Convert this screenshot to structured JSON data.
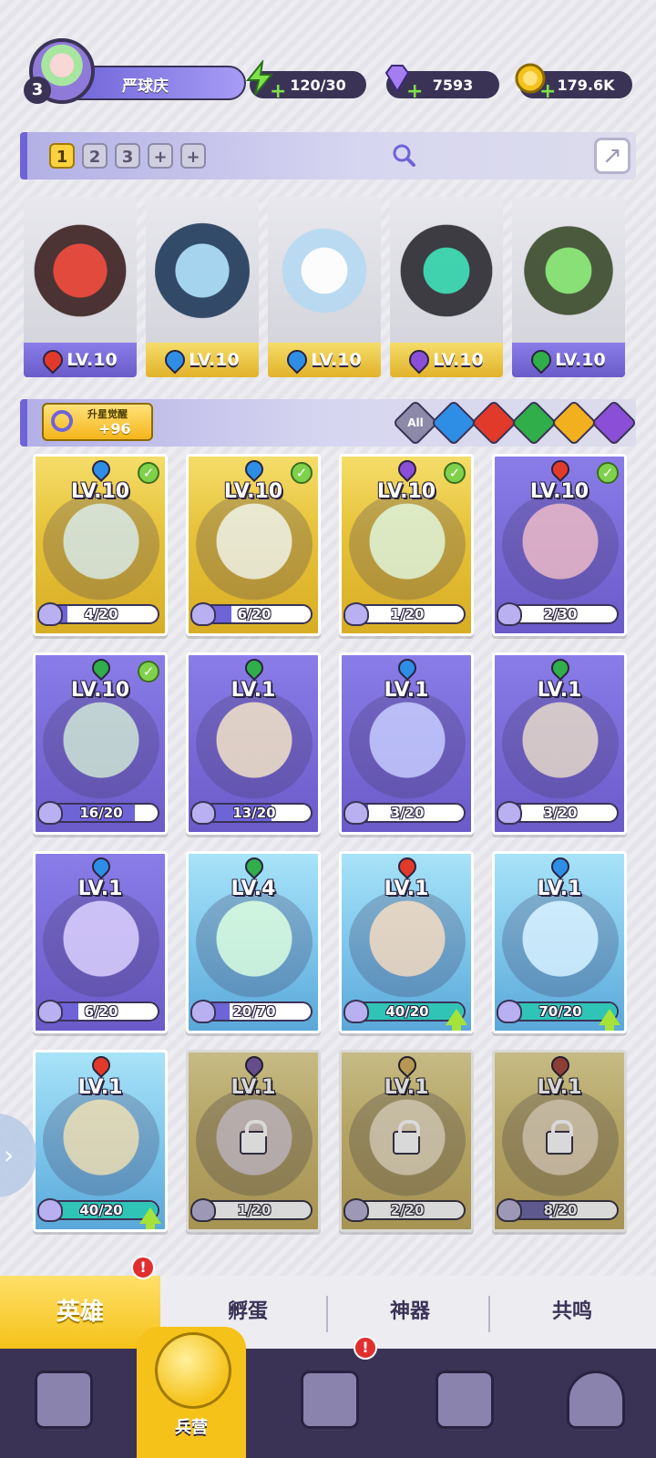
{
  "player": {
    "level": "3",
    "name": "严球庆"
  },
  "resources": {
    "energy": "120/30",
    "gems": "7593",
    "coins": "179.6K"
  },
  "team_tabs": [
    "1",
    "2",
    "3",
    "+",
    "+"
  ],
  "team_slots": [
    {
      "level": "LV.10",
      "element": "fire"
    },
    {
      "level": "LV.10",
      "element": "water"
    },
    {
      "level": "LV.10",
      "element": "water"
    },
    {
      "level": "LV.10",
      "element": "moon"
    },
    {
      "level": "LV.10",
      "element": "nature"
    }
  ],
  "awaken": {
    "label": "升星觉醒",
    "value": "+96"
  },
  "element_filters": [
    "All",
    "water",
    "fire",
    "nature",
    "light",
    "moon"
  ],
  "heroes": [
    {
      "level": "LV.10",
      "progress": "4/20",
      "element": "water",
      "card": "gold",
      "checked": true
    },
    {
      "level": "LV.10",
      "progress": "6/20",
      "element": "water",
      "card": "gold",
      "checked": true
    },
    {
      "level": "LV.10",
      "progress": "1/20",
      "element": "moon",
      "card": "gold",
      "checked": true
    },
    {
      "level": "LV.10",
      "progress": "2/30",
      "element": "fire",
      "card": "purple",
      "checked": true
    },
    {
      "level": "LV.10",
      "progress": "16/20",
      "element": "nature",
      "card": "purple",
      "checked": true
    },
    {
      "level": "LV.1",
      "progress": "13/20",
      "element": "nature",
      "card": "purple"
    },
    {
      "level": "LV.1",
      "progress": "3/20",
      "element": "water",
      "card": "purple"
    },
    {
      "level": "LV.1",
      "progress": "3/20",
      "element": "nature",
      "card": "purple"
    },
    {
      "level": "LV.1",
      "progress": "6/20",
      "element": "water",
      "card": "purple"
    },
    {
      "level": "LV.4",
      "progress": "20/70",
      "element": "nature",
      "card": "blue"
    },
    {
      "level": "LV.1",
      "progress": "40/20",
      "element": "fire",
      "card": "blue",
      "upgrade": true
    },
    {
      "level": "LV.1",
      "progress": "70/20",
      "element": "water",
      "card": "blue",
      "upgrade": true
    },
    {
      "level": "LV.1",
      "progress": "40/20",
      "element": "fire",
      "card": "blue",
      "upgrade": true
    },
    {
      "level": "LV.1",
      "progress": "1/20",
      "element": "moon",
      "card": "gold",
      "locked": true
    },
    {
      "level": "LV.1",
      "progress": "2/20",
      "element": "light",
      "card": "gold",
      "locked": true
    },
    {
      "level": "LV.1",
      "progress": "8/20",
      "element": "fire",
      "card": "gold",
      "locked": true
    }
  ],
  "sub_tabs": [
    "英雄",
    "孵蛋",
    "神器",
    "共鸣"
  ],
  "bottom_nav": [
    {
      "icon": "cards-icon",
      "label": ""
    },
    {
      "icon": "barracks-icon",
      "label": "兵营"
    },
    {
      "icon": "map-book-icon",
      "label": ""
    },
    {
      "icon": "locked-building-icon",
      "label": ""
    },
    {
      "icon": "mushroom-icon",
      "label": ""
    }
  ],
  "colors": {
    "water": "#2e8ee6",
    "fire": "#e23a2a",
    "nature": "#2fae4a",
    "moon": "#8a4fd6",
    "light": "#f2b01e"
  }
}
